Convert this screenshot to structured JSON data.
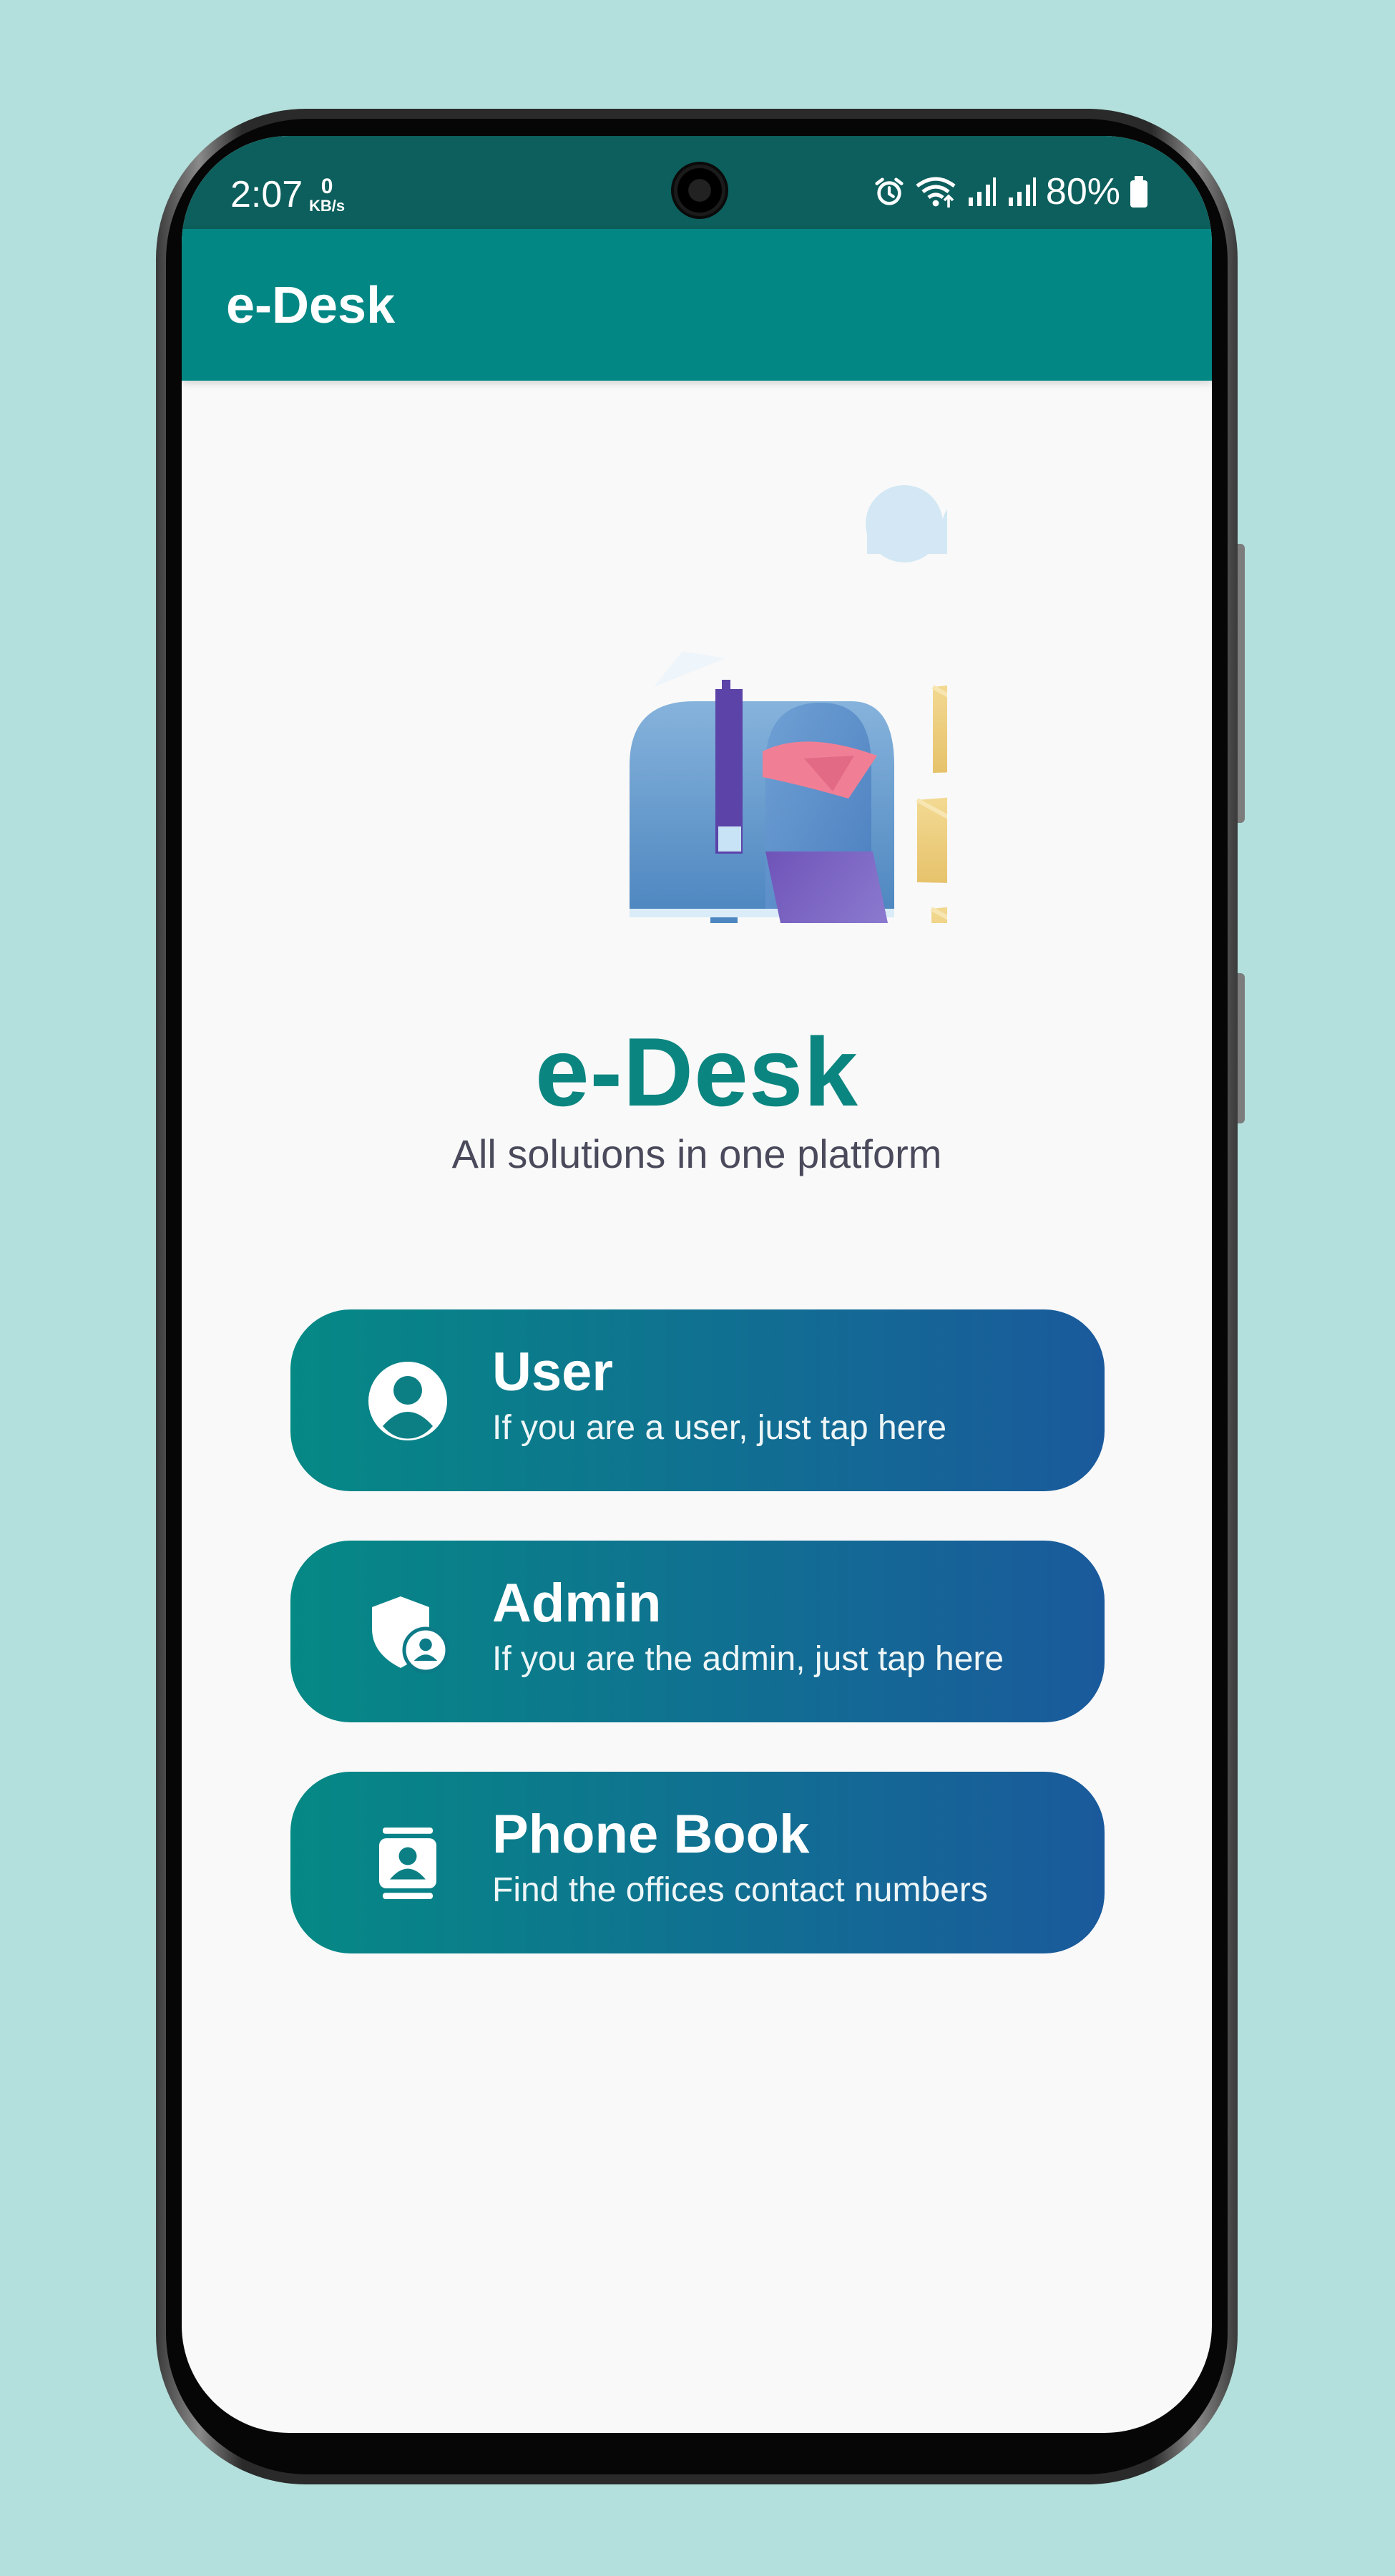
{
  "status_bar": {
    "time": "2:07",
    "data_rate_value": "0",
    "data_rate_unit": "KB/s",
    "battery": "80%",
    "icons": [
      "alarm-icon",
      "wifi-icon",
      "signal-icon",
      "signal-icon",
      "battery-icon"
    ]
  },
  "app_bar": {
    "title": "e-Desk"
  },
  "hero": {
    "title": "e-Desk",
    "subtitle": "All solutions in one platform"
  },
  "menu": [
    {
      "title": "User",
      "description": "If you are a user, just tap here",
      "icon": "user-circle-icon"
    },
    {
      "title": "Admin",
      "description": "If you are the admin, just tap here",
      "icon": "admin-shield-icon"
    },
    {
      "title": "Phone Book",
      "description": "Find the offices contact numbers",
      "icon": "contact-book-icon"
    }
  ],
  "colors": {
    "background": "#b3e0dc",
    "status_bar": "#0c5f5c",
    "app_bar": "#028784",
    "title_teal": "#0b8580",
    "card_gradient_start": "#058985",
    "card_gradient_end": "#1a5a9c",
    "screen_bg": "#f9f9f9"
  }
}
